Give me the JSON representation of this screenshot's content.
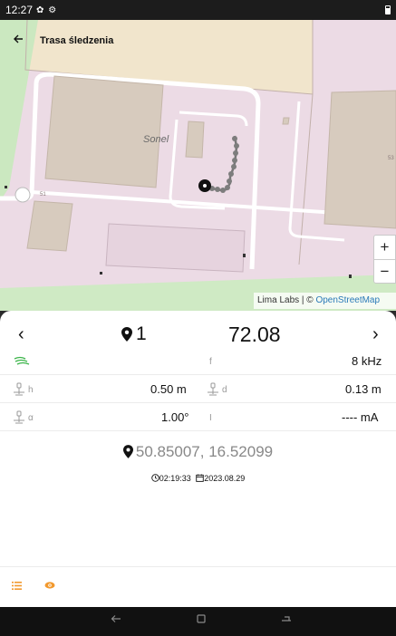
{
  "status_bar": {
    "time": "12:27",
    "icons": "✿ ⚙"
  },
  "header": {
    "back_icon": "arrow-left-icon",
    "title": "Trasa śledzenia"
  },
  "map": {
    "label_sonel": "Sonel",
    "label_51": "51",
    "label_53": "53",
    "zoom_in": "+",
    "zoom_out": "−",
    "attribution_text": "Lima Labs | © ",
    "attribution_link": "OpenStreetMap"
  },
  "panel": {
    "prev": "‹",
    "next": "›",
    "point_number": "1",
    "reading_value": "72.08",
    "rows": {
      "f_label": "f",
      "f_value": "8 kHz",
      "h_label": "h",
      "h_value": "0.50 m",
      "d_label": "d",
      "d_value": "0.13 m",
      "a_label": "α",
      "a_value": "1.00°",
      "i_label": "I",
      "i_value": "---- mA"
    },
    "coordinates": "50.85007, 16.52099",
    "time": "02:19:33",
    "date": "2023.08.29"
  },
  "colors": {
    "accent_orange": "#f2992e",
    "signal_green": "#3cb54a"
  },
  "icons": {
    "signal": "signal-waves-icon",
    "depth": "locator-depth-icon",
    "list": "list-icon",
    "eye": "eye-icon"
  }
}
